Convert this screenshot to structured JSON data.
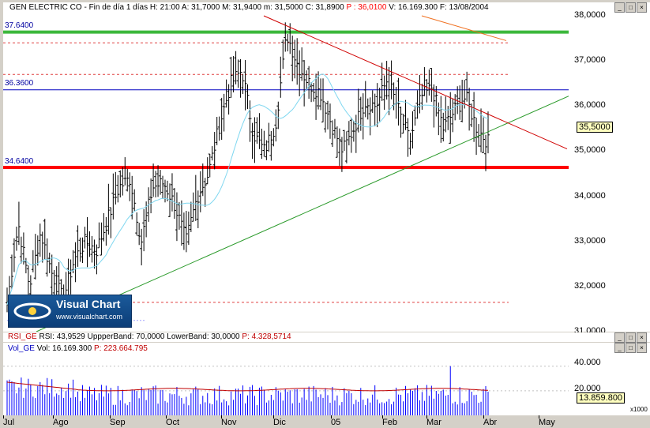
{
  "header": {
    "symbol": "GEN ELECTRIC CO",
    "timeframe": "Fin de día 1 días",
    "h": "H: 21:00",
    "a": "A: 31,7000",
    "m": "M: 31,9400",
    "mm": "m: 31,5000",
    "c": "C: 31,8900",
    "p": "P : 36,0100",
    "v": "V: 16.169.300",
    "f": "F: 13/08/2004"
  },
  "rsi_header": {
    "name": "RSI_GE",
    "rsi": "RSI: 43,9529",
    "upper": "UppperBand: 70,0000",
    "lower": "LowerBand: 30,0000",
    "p": "P: 4.328,5714"
  },
  "vol_header": {
    "name": "Vol_GE",
    "vol": "Vol: 16.169.300",
    "p": "P: 223.664.795"
  },
  "logo": {
    "title": "Visual Chart",
    "url": "www.visualchart.com"
  },
  "price_axis": [
    "38,0000",
    "37,0000",
    "36,0000",
    "35,0000",
    "34,0000",
    "33,0000",
    "32,0000",
    "31,0000"
  ],
  "current_price": "35,5000",
  "vol_axis": [
    "40.000",
    "20.000"
  ],
  "vol_current": "13.859.800",
  "vol_multiplier": "x1000",
  "months": [
    "Jul",
    "Ago",
    "Sep",
    "Oct",
    "Nov",
    "Dic",
    "05",
    "Feb",
    "Mar",
    "Abr",
    "May"
  ],
  "levels": {
    "l1": "37.6400",
    "l2": "36.3600",
    "l3": "34.6400"
  },
  "colors": {
    "green_line": "#3cb83c",
    "red_line": "#ff0000",
    "blue_line": "#0000c0",
    "ma_line": "#7fd7f0",
    "bars": "#000000",
    "vol_bars": "#0000ff",
    "vol_ma": "#c00000"
  },
  "chart_data": {
    "type": "ohlc",
    "title": "GEN ELECTRIC CO",
    "ylim": [
      31.0,
      38.0
    ],
    "x_months": [
      "Jul 2004",
      "Ago",
      "Sep",
      "Oct",
      "Nov",
      "Dic",
      "Ene 2005",
      "Feb",
      "Mar",
      "Abr",
      "May"
    ],
    "close_path": [
      31.6,
      33.4,
      32.0,
      33.2,
      32.3,
      31.7,
      32.6,
      33.0,
      32.8,
      33.5,
      34.2,
      34.4,
      33.0,
      34.2,
      34.3,
      33.8,
      33.0,
      34.0,
      34.5,
      35.6,
      36.5,
      36.8,
      35.4,
      35.0,
      35.6,
      37.6,
      36.9,
      36.5,
      36.3,
      35.6,
      35.0,
      35.5,
      36.1,
      36.0,
      36.6,
      35.9,
      35.2,
      36.2,
      36.4,
      35.5,
      35.9,
      36.2,
      35.5,
      35.2
    ],
    "horizontal_levels": [
      37.64,
      36.36,
      34.64
    ],
    "support_trendline": {
      "from": [
        "Ago 2004",
        31.0
      ],
      "to": [
        "Abr 2005",
        36.2
      ]
    },
    "resistance_trendline": {
      "from": [
        "Dic 2004",
        38.0
      ],
      "to": [
        "Abr 2005",
        35.0
      ]
    },
    "indicators": {
      "rsi": 43.9529,
      "upper_band": 70.0,
      "lower_band": 30.0
    },
    "volume": {
      "last": 16169300,
      "axis_ticks": [
        40000,
        20000
      ],
      "unit": "x1000"
    }
  }
}
